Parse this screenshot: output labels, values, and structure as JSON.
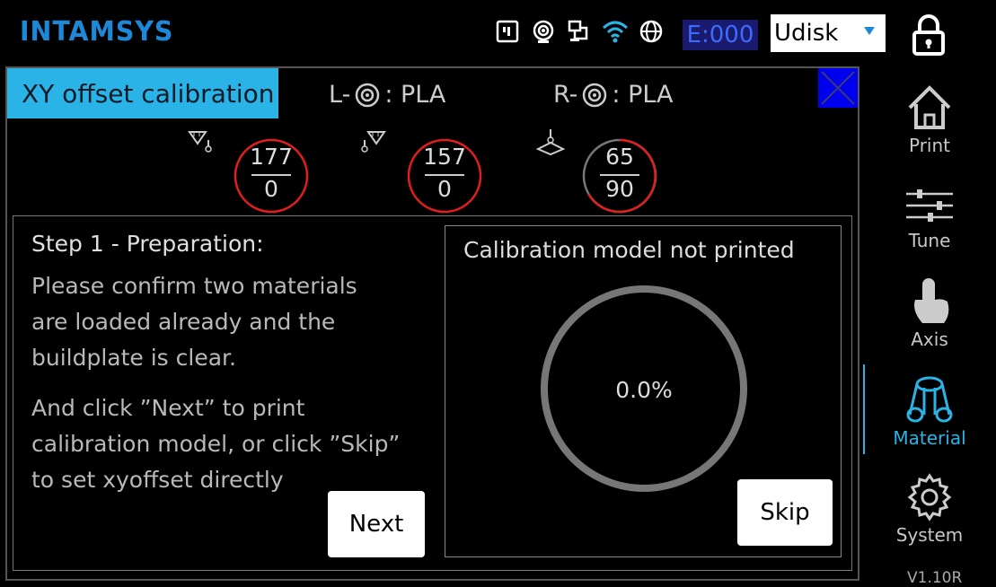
{
  "header": {
    "logo": "INTAMSYS",
    "status_icons": [
      "sd-card-icon",
      "camera-icon",
      "network-icon",
      "wifi-icon",
      "globe-icon"
    ],
    "error_code": "E:000",
    "storage_select": "Udisk"
  },
  "panel": {
    "title": "XY offset calibration",
    "left_material": {
      "prefix": "L-",
      "name": ": PLA"
    },
    "right_material": {
      "prefix": "R-",
      "name": ": PLA"
    },
    "temps": [
      {
        "name": "left-nozzle",
        "current": "177",
        "target": "0"
      },
      {
        "name": "right-nozzle",
        "current": "157",
        "target": "0"
      },
      {
        "name": "bed",
        "current": "65",
        "target": "90"
      }
    ],
    "step_title": "Step 1 - Preparation:",
    "instructions_1": [
      "Please confirm two materials",
      "are loaded already and the",
      "buildplate is clear."
    ],
    "instructions_2": [
      "And click ”Next” to print",
      "calibration model, or click ”Skip”",
      "to set xyoffset directly"
    ],
    "next_label": "Next",
    "model_status": "Calibration model not printed",
    "progress": "0.0%",
    "skip_label": "Skip"
  },
  "sidebar": {
    "items": [
      {
        "label": "Print",
        "icon": "house-icon",
        "active": false
      },
      {
        "label": "Tune",
        "icon": "sliders-icon",
        "active": false
      },
      {
        "label": "Axis",
        "icon": "hand-pointer-icon",
        "active": false
      },
      {
        "label": "Material",
        "icon": "filament-spool-icon",
        "active": true
      },
      {
        "label": "System",
        "icon": "gear-icon",
        "active": false
      }
    ],
    "version": "V1.10R"
  },
  "colors": {
    "accent": "#2ab3e6",
    "brand": "#1e88d8",
    "close": "#0000ee",
    "gauge_ring": "#e01e1e"
  }
}
